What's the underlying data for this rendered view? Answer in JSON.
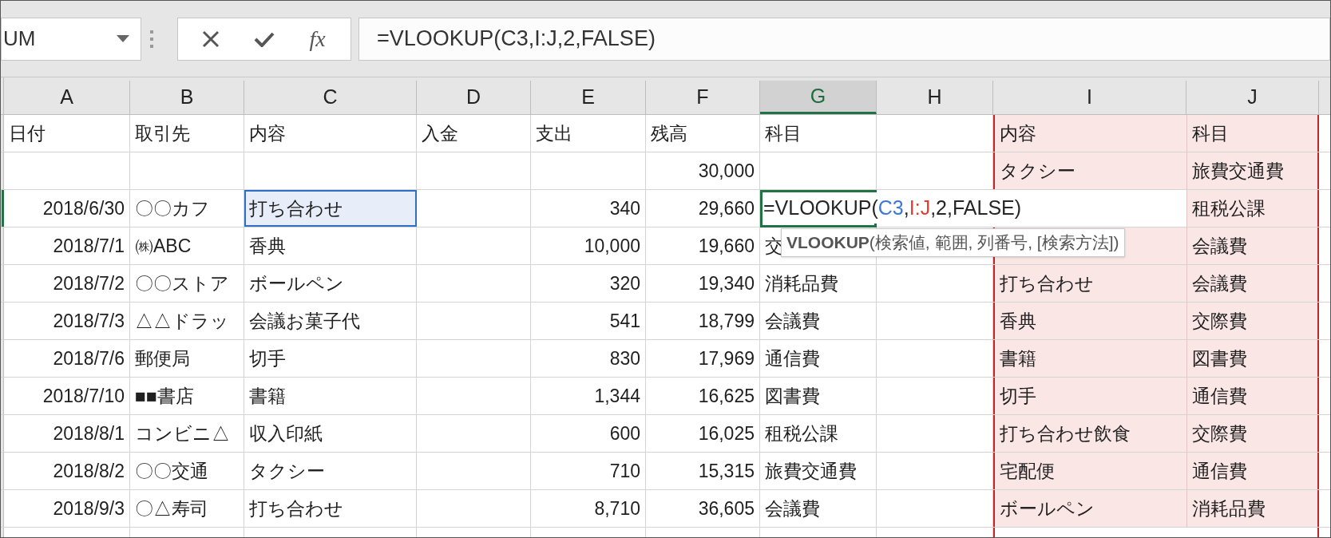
{
  "name_box": {
    "value": "UM"
  },
  "formula_bar": {
    "function_button": "fx",
    "formula": "=VLOOKUP(C3,I:J,2,FALSE)"
  },
  "columns": [
    {
      "label": "A",
      "selected": false,
      "range_highlighted": false
    },
    {
      "label": "B",
      "selected": false,
      "range_highlighted": false
    },
    {
      "label": "C",
      "selected": false,
      "range_highlighted": false
    },
    {
      "label": "D",
      "selected": false,
      "range_highlighted": false
    },
    {
      "label": "E",
      "selected": false,
      "range_highlighted": false
    },
    {
      "label": "F",
      "selected": false,
      "range_highlighted": false
    },
    {
      "label": "G",
      "selected": true,
      "range_highlighted": false
    },
    {
      "label": "H",
      "selected": false,
      "range_highlighted": false
    },
    {
      "label": "I",
      "selected": false,
      "range_highlighted": true
    },
    {
      "label": "J",
      "selected": false,
      "range_highlighted": true
    }
  ],
  "rows": [
    {
      "cells": [
        {
          "text": "日付",
          "kind": "text",
          "selected": false
        },
        {
          "text": "取引先",
          "kind": "text",
          "selected": false
        },
        {
          "text": "内容",
          "kind": "text",
          "selected": false
        },
        {
          "text": "入金",
          "kind": "text",
          "selected": false
        },
        {
          "text": "支出",
          "kind": "text",
          "selected": false
        },
        {
          "text": "残高",
          "kind": "text",
          "selected": false
        },
        {
          "text": "科目",
          "kind": "text",
          "selected": false
        },
        null,
        {
          "text": "内容",
          "kind": "text",
          "selected": false
        },
        {
          "text": "科目",
          "kind": "text",
          "selected": false
        }
      ]
    },
    {
      "cells": [
        null,
        null,
        null,
        null,
        null,
        {
          "text": "30,000",
          "kind": "number",
          "selected": false
        },
        null,
        null,
        {
          "text": "タクシー",
          "kind": "text",
          "selected": false
        },
        {
          "text": "旅費交通費",
          "kind": "text",
          "selected": false
        }
      ]
    },
    {
      "cells": [
        {
          "text": "2018/6/30",
          "kind": "number",
          "selected": false
        },
        {
          "text": "〇〇カフ",
          "kind": "text",
          "selected": false
        },
        {
          "text": "打ち合わせ",
          "kind": "text",
          "selected": true
        },
        null,
        {
          "text": "340",
          "kind": "number",
          "selected": false
        },
        {
          "text": "29,660",
          "kind": "number",
          "selected": false
        },
        null,
        null,
        null,
        {
          "text": "租税公課",
          "kind": "text",
          "selected": false
        }
      ],
      "editor": {
        "parts": [
          {
            "text": "=VLOOKUP(",
            "color": "#262626"
          },
          {
            "text": "C3",
            "color": "#3c78d8"
          },
          {
            "text": ",",
            "color": "#262626"
          },
          {
            "text": "I:J",
            "color": "#e03c31"
          },
          {
            "text": ",2,FALSE)",
            "color": "#262626"
          }
        ],
        "tooltip": "**VLOOKUP**(検索値, 範囲, 列番号, [検索方法])"
      }
    },
    {
      "cells": [
        {
          "text": "2018/7/1",
          "kind": "number",
          "selected": false
        },
        {
          "text": "㈱ABC",
          "kind": "text",
          "selected": false
        },
        {
          "text": "香典",
          "kind": "text",
          "selected": false
        },
        null,
        {
          "text": "10,000",
          "kind": "number",
          "selected": false
        },
        {
          "text": "19,660",
          "kind": "number",
          "selected": false
        },
        {
          "text": "交",
          "kind": "text",
          "selected": false
        },
        null,
        null,
        {
          "text": "会議費",
          "kind": "text",
          "selected": false
        }
      ]
    },
    {
      "cells": [
        {
          "text": "2018/7/2",
          "kind": "number",
          "selected": false
        },
        {
          "text": "〇〇ストア",
          "kind": "text",
          "selected": false
        },
        {
          "text": "ボールペン",
          "kind": "text",
          "selected": false
        },
        null,
        {
          "text": "320",
          "kind": "number",
          "selected": false
        },
        {
          "text": "19,340",
          "kind": "number",
          "selected": false
        },
        {
          "text": "消耗品費",
          "kind": "text",
          "selected": false
        },
        null,
        {
          "text": "打ち合わせ",
          "kind": "text",
          "selected": false
        },
        {
          "text": "会議費",
          "kind": "text",
          "selected": false
        }
      ]
    },
    {
      "cells": [
        {
          "text": "2018/7/3",
          "kind": "number",
          "selected": false
        },
        {
          "text": "△△ドラッ",
          "kind": "text",
          "selected": false
        },
        {
          "text": "会議お菓子代",
          "kind": "text",
          "selected": false
        },
        null,
        {
          "text": "541",
          "kind": "number",
          "selected": false
        },
        {
          "text": "18,799",
          "kind": "number",
          "selected": false
        },
        {
          "text": "会議費",
          "kind": "text",
          "selected": false
        },
        null,
        {
          "text": "香典",
          "kind": "text",
          "selected": false
        },
        {
          "text": "交際費",
          "kind": "text",
          "selected": false
        }
      ]
    },
    {
      "cells": [
        {
          "text": "2018/7/6",
          "kind": "number",
          "selected": false
        },
        {
          "text": "郵便局",
          "kind": "text",
          "selected": false
        },
        {
          "text": "切手",
          "kind": "text",
          "selected": false
        },
        null,
        {
          "text": "830",
          "kind": "number",
          "selected": false
        },
        {
          "text": "17,969",
          "kind": "number",
          "selected": false
        },
        {
          "text": "通信費",
          "kind": "text",
          "selected": false
        },
        null,
        {
          "text": "書籍",
          "kind": "text",
          "selected": false
        },
        {
          "text": "図書費",
          "kind": "text",
          "selected": false
        }
      ]
    },
    {
      "cells": [
        {
          "text": "2018/7/10",
          "kind": "number",
          "selected": false
        },
        {
          "text": "■■書店",
          "kind": "text",
          "selected": false
        },
        {
          "text": "書籍",
          "kind": "text",
          "selected": false
        },
        null,
        {
          "text": "1,344",
          "kind": "number",
          "selected": false
        },
        {
          "text": "16,625",
          "kind": "number",
          "selected": false
        },
        {
          "text": "図書費",
          "kind": "text",
          "selected": false
        },
        null,
        {
          "text": "切手",
          "kind": "text",
          "selected": false
        },
        {
          "text": "通信費",
          "kind": "text",
          "selected": false
        }
      ]
    },
    {
      "cells": [
        {
          "text": "2018/8/1",
          "kind": "number",
          "selected": false
        },
        {
          "text": "コンビニ△",
          "kind": "text",
          "selected": false
        },
        {
          "text": "収入印紙",
          "kind": "text",
          "selected": false
        },
        null,
        {
          "text": "600",
          "kind": "number",
          "selected": false
        },
        {
          "text": "16,025",
          "kind": "number",
          "selected": false
        },
        {
          "text": "租税公課",
          "kind": "text",
          "selected": false
        },
        null,
        {
          "text": "打ち合わせ飲食",
          "kind": "text",
          "selected": false
        },
        {
          "text": "交際費",
          "kind": "text",
          "selected": false
        }
      ]
    },
    {
      "cells": [
        {
          "text": "2018/8/2",
          "kind": "number",
          "selected": false
        },
        {
          "text": "〇〇交通",
          "kind": "text",
          "selected": false
        },
        {
          "text": "タクシー",
          "kind": "text",
          "selected": false
        },
        null,
        {
          "text": "710",
          "kind": "number",
          "selected": false
        },
        {
          "text": "15,315",
          "kind": "number",
          "selected": false
        },
        {
          "text": "旅費交通費",
          "kind": "text",
          "selected": false
        },
        null,
        {
          "text": "宅配便",
          "kind": "text",
          "selected": false
        },
        {
          "text": "通信費",
          "kind": "text",
          "selected": false
        }
      ]
    },
    {
      "cells": [
        {
          "text": "2018/9/3",
          "kind": "number",
          "selected": false
        },
        {
          "text": "〇△寿司",
          "kind": "text",
          "selected": false
        },
        {
          "text": "打ち合わせ",
          "kind": "text",
          "selected": false
        },
        null,
        {
          "text": "8,710",
          "kind": "number",
          "selected": false
        },
        {
          "text": "36,605",
          "kind": "number",
          "selected": false
        },
        {
          "text": "会議費",
          "kind": "text",
          "selected": false
        },
        null,
        {
          "text": "ボールペン",
          "kind": "text",
          "selected": false
        },
        {
          "text": "消耗品費",
          "kind": "text",
          "selected": false
        }
      ]
    }
  ]
}
